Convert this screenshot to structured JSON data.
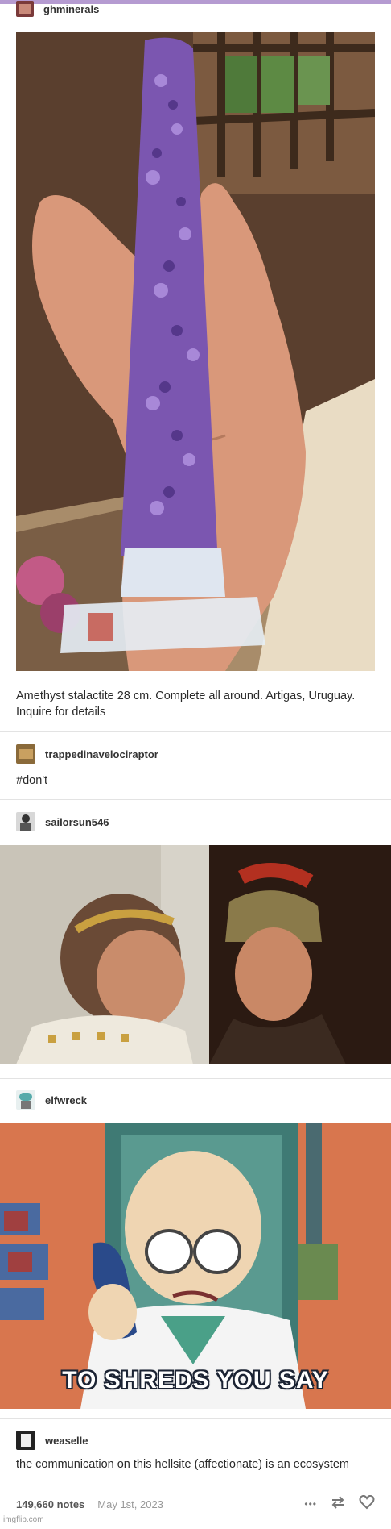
{
  "posts": [
    {
      "username": "ghminerals",
      "caption": "Amethyst stalactite 28 cm. Complete all around. Artigas, Uruguay. Inquire for details"
    },
    {
      "username": "trappedinavelociraptor",
      "caption": "#don't"
    },
    {
      "username": "sailorsun546"
    },
    {
      "username": "elfwreck",
      "meme_text": "TO SHREDS YOU SAY"
    },
    {
      "username": "weaselle",
      "caption": "the communication on this hellsite (affectionate) is an ecosystem"
    }
  ],
  "footer": {
    "notes": "149,660 notes",
    "date": "May 1st, 2023",
    "more_icon": "•••"
  },
  "watermark": "imgflip.com",
  "colors": {
    "accent_bar": "#b59bd1"
  }
}
